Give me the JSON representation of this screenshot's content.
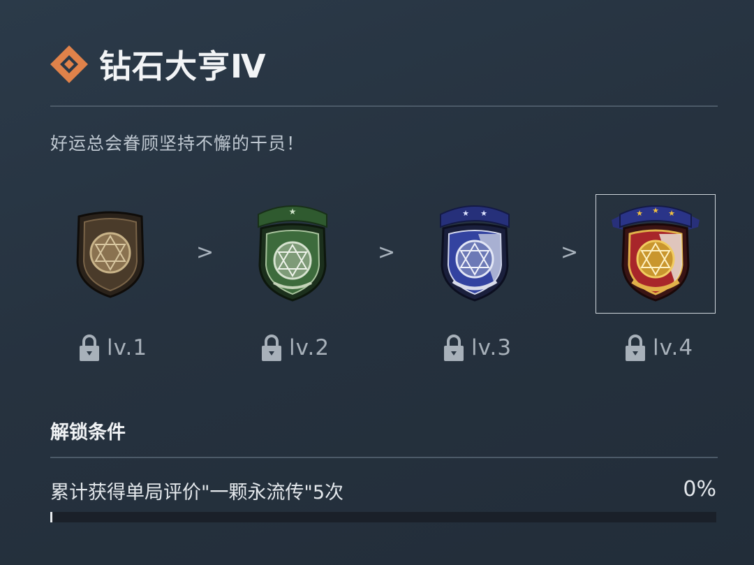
{
  "header": {
    "title": "钻石大亨Ⅳ",
    "accent_color": "#e0824a",
    "icon": "diamond-emblem-icon"
  },
  "subtitle": "好运总会眷顾坚持不懈的干员！",
  "levels": [
    {
      "label": "lv.1",
      "locked": true,
      "badge": "brown-shield-badge"
    },
    {
      "label": "lv.2",
      "locked": true,
      "badge": "green-shield-badge"
    },
    {
      "label": "lv.3",
      "locked": true,
      "badge": "blue-shield-badge"
    },
    {
      "label": "lv.4",
      "locked": true,
      "badge": "red-gold-shield-badge",
      "selected": true
    }
  ],
  "separator": ">",
  "unlock": {
    "title": "解锁条件",
    "condition": "累计获得单局评价\"一颗永流传\"5次",
    "progress_label": "0%",
    "progress": 0
  }
}
